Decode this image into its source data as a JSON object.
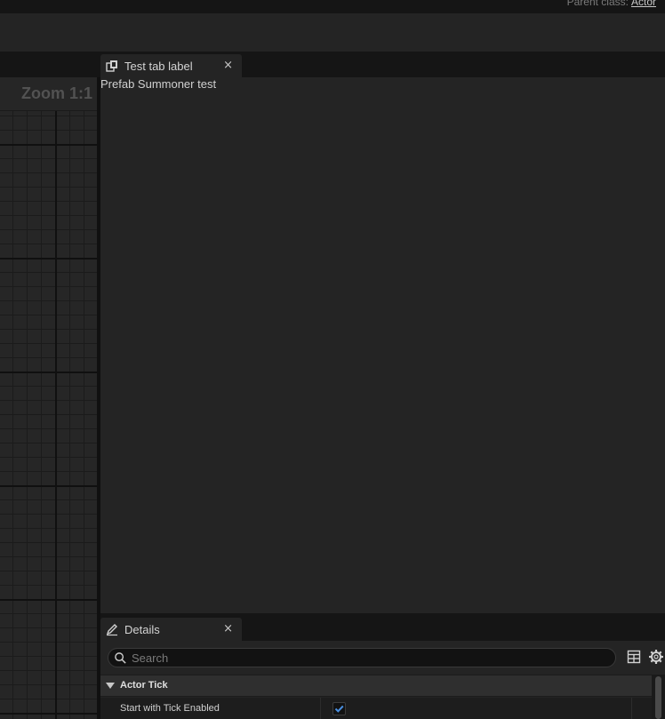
{
  "header": {
    "parent_class_label": "Parent class:",
    "parent_class_value": "Actor"
  },
  "graph": {
    "zoom_label": "Zoom 1:1"
  },
  "test_tab": {
    "label": "Test tab label",
    "close_glyph": "×",
    "content_text": "Prefab Summoner test"
  },
  "details": {
    "tab_label": "Details",
    "close_glyph": "×",
    "search": {
      "placeholder": "Search",
      "value": ""
    },
    "categories": [
      {
        "label": "Actor Tick",
        "expanded": true,
        "properties": [
          {
            "name": "Start with Tick Enabled",
            "checked": true
          }
        ]
      }
    ]
  },
  "icons": {
    "test_tab": "blueprint-tab-icon",
    "details_tab": "pencil-icon",
    "search": "search-icon",
    "view_options": "table-view-icon",
    "settings": "gear-icon",
    "expand": "triangle-down-icon",
    "check": "checkmark-icon"
  },
  "colors": {
    "accent": "#4a90e2",
    "panel_bg": "#242424",
    "dark_bg": "#151515"
  }
}
